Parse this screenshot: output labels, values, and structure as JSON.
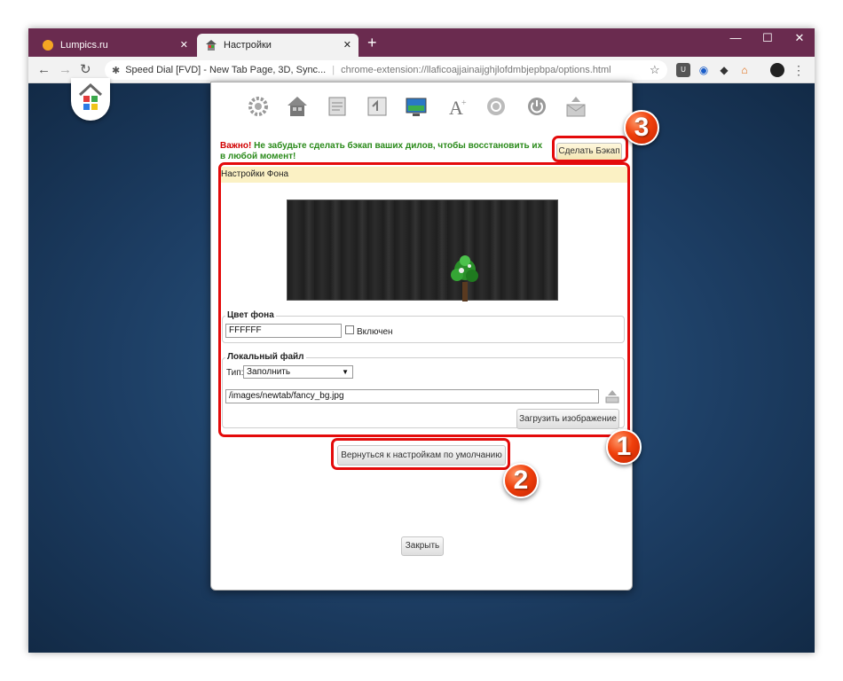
{
  "tabs": [
    {
      "label": "Lumpics.ru",
      "favicon_color": "#f5a623"
    },
    {
      "label": "Настройки"
    }
  ],
  "toolbar": {
    "page_title": "Speed Dial [FVD] - New Tab Page, 3D, Sync...",
    "url": "chrome-extension://llaficoajjainaijghjlofdmbjepbpa/options.html"
  },
  "settings": {
    "warning_important": "Важно!",
    "warning_text": "Не забудьте сделать бэкап ваших дилов, чтобы восстановить их в любой момент!",
    "backup_button": "Сделать Бэкап",
    "section_title": "Настройки Фона",
    "bg_color": {
      "legend": "Цвет фона",
      "value": "FFFFFF",
      "enabled_label": "Включен"
    },
    "local_file": {
      "legend": "Локальный файл",
      "type_label": "Тип:",
      "type_value": "Заполнить",
      "path": "/images/newtab/fancy_bg.jpg",
      "upload_button": "Загрузить изображение"
    },
    "reset_button": "Вернуться к настройкам по умолчанию",
    "close_button": "Закрыть"
  },
  "annotations": {
    "one": "1",
    "two": "2",
    "three": "3"
  },
  "colors": {
    "tabbar": "#6a2b4f",
    "highlight": "#e40b0b",
    "warning": "#2a8a1a",
    "important": "#d10000"
  }
}
